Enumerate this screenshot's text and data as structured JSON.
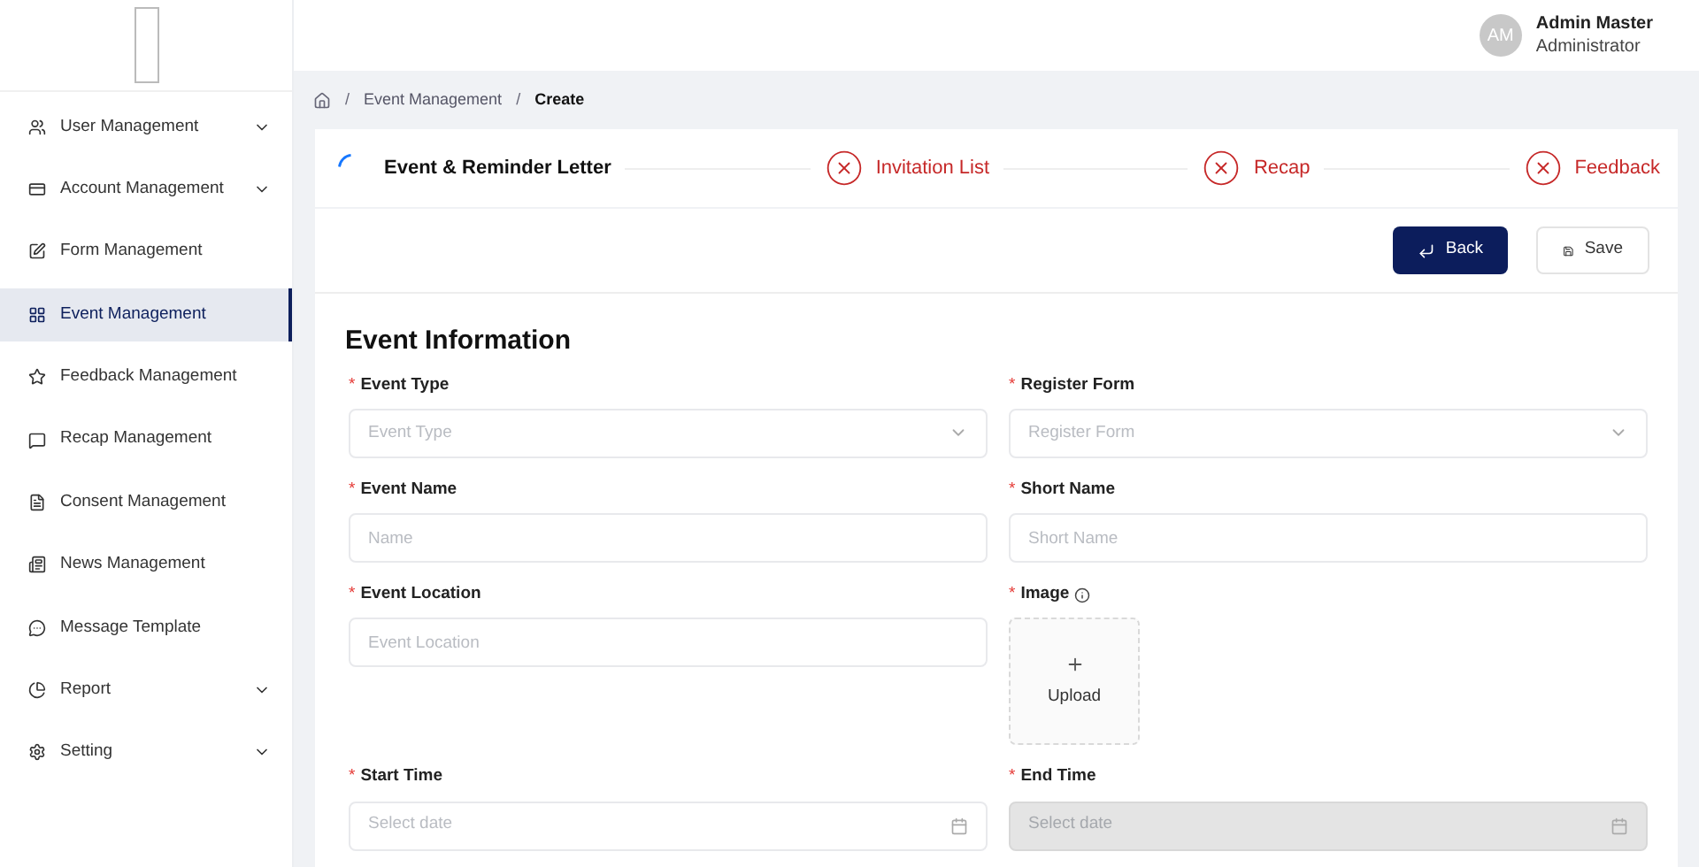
{
  "user": {
    "initials": "AM",
    "name": "Admin Master",
    "role": "Administrator"
  },
  "sidebar": {
    "items": [
      {
        "label": "User Management",
        "expandable": true,
        "selected": false
      },
      {
        "label": "Account Management",
        "expandable": true,
        "selected": false
      },
      {
        "label": "Form Management",
        "expandable": false,
        "selected": false
      },
      {
        "label": "Event Management",
        "expandable": false,
        "selected": true
      },
      {
        "label": "Feedback Management",
        "expandable": false,
        "selected": false
      },
      {
        "label": "Recap Management",
        "expandable": false,
        "selected": false
      },
      {
        "label": "Consent Management",
        "expandable": false,
        "selected": false
      },
      {
        "label": "News Management",
        "expandable": false,
        "selected": false
      },
      {
        "label": "Message Template",
        "expandable": false,
        "selected": false
      },
      {
        "label": "Report",
        "expandable": true,
        "selected": false
      },
      {
        "label": "Setting",
        "expandable": true,
        "selected": false
      }
    ]
  },
  "breadcrumb": [
    {
      "separator": "/",
      "label": "Event Management",
      "current": false
    },
    {
      "separator": "/",
      "label": "Create",
      "current": true
    }
  ],
  "steps": [
    {
      "label": "Event & Reminder Letter",
      "kind": "process"
    },
    {
      "label": "Invitation List",
      "kind": "error"
    },
    {
      "label": "Recap",
      "kind": "error"
    },
    {
      "label": "Feedback",
      "kind": "error"
    }
  ],
  "actions": [
    {
      "label": "Back",
      "kind": "primary"
    },
    {
      "label": "Save",
      "kind": "default"
    }
  ],
  "form": {
    "title": "Event Information",
    "fields": [
      {
        "required_mark": "*",
        "label": "Event Type",
        "kind": "select",
        "placeholder": "Event Type"
      },
      {
        "required_mark": "*",
        "label": "Register Form",
        "kind": "select",
        "placeholder": "Register Form"
      },
      {
        "required_mark": "*",
        "label": "Event Name",
        "kind": "input",
        "placeholder": "Name"
      },
      {
        "required_mark": "*",
        "label": "Short Name",
        "kind": "input",
        "placeholder": "Short Name"
      },
      {
        "required_mark": "*",
        "label": "Event Location",
        "kind": "input",
        "placeholder": "Event Location"
      },
      {
        "required_mark": "*",
        "label": "Image",
        "kind": "upload",
        "upload_label": "Upload"
      },
      {
        "required_mark": "*",
        "label": "Start Time",
        "kind": "date",
        "placeholder": "Select date",
        "disabled": false
      },
      {
        "required_mark": "*",
        "label": "End Time",
        "kind": "date",
        "placeholder": "Select date",
        "disabled": true
      }
    ]
  }
}
